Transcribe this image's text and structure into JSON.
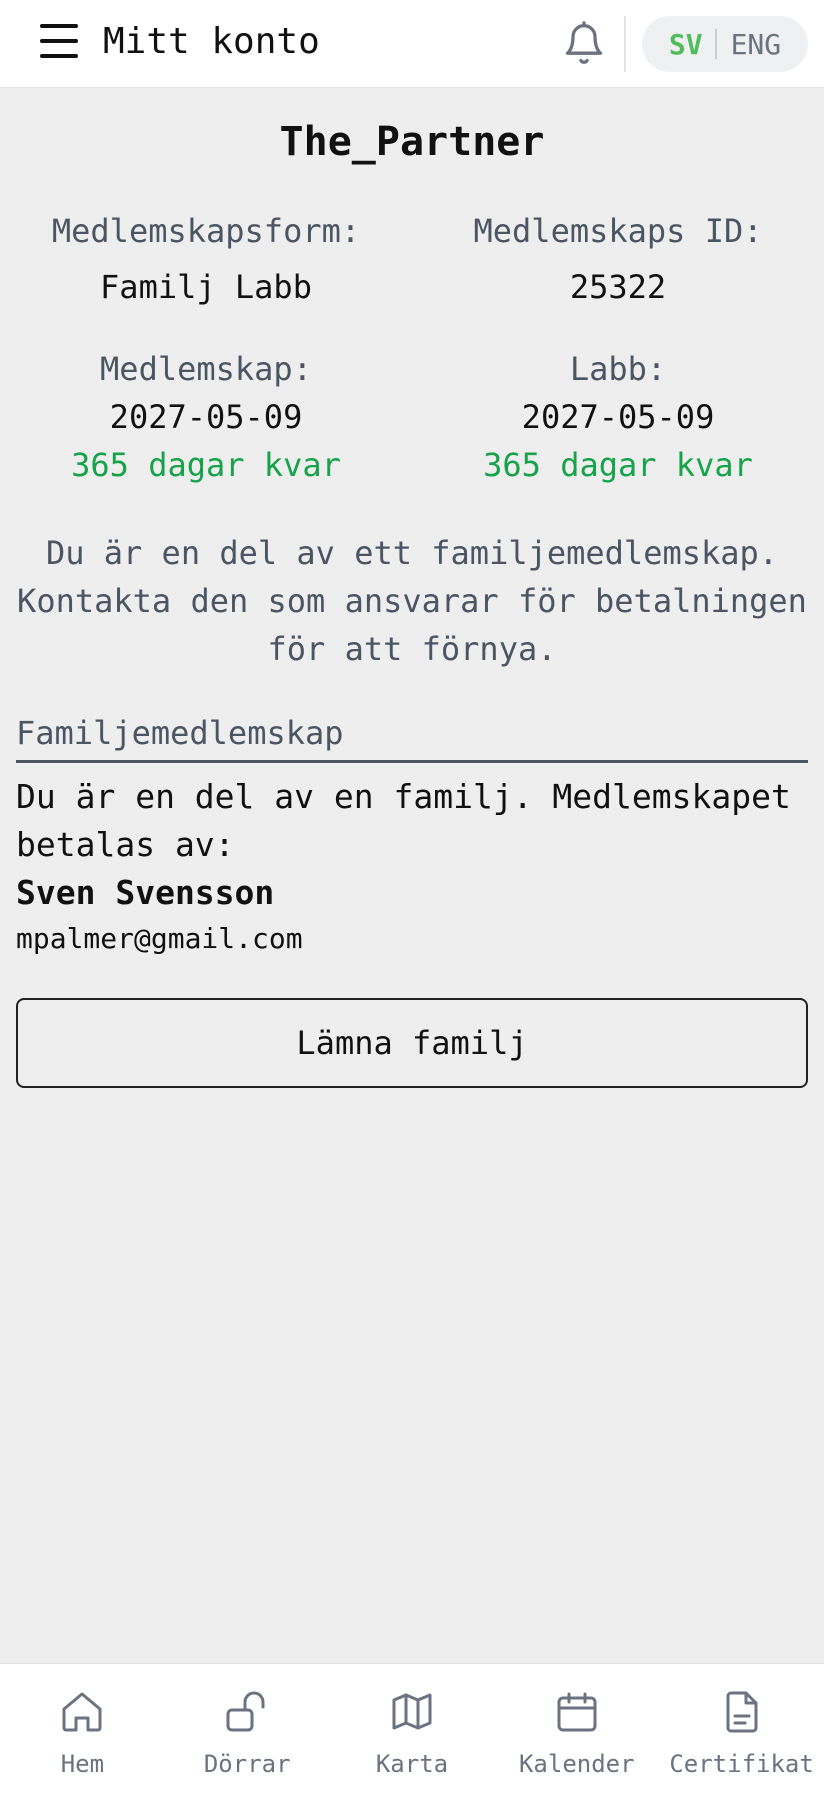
{
  "header": {
    "title": "Mitt konto",
    "menu_icon": "hamburger-icon",
    "bell_icon": "bell-icon",
    "lang": {
      "sv": "SV",
      "eng": "ENG",
      "active": "SV"
    }
  },
  "profile": {
    "name": "The_Partner",
    "membership_type_label": "Medlemskapsform:",
    "membership_type_value": "Familj Labb",
    "membership_id_label": "Medlemskaps ID:",
    "membership_id_value": "25322",
    "membership_label": "Medlemskap:",
    "membership_date": "2027-05-09",
    "membership_remaining": "365 dagar kvar",
    "lab_label": "Labb:",
    "lab_date": "2027-05-09",
    "lab_remaining": "365 dagar kvar"
  },
  "notice": {
    "line1": "Du är en del av ett familjemedlemskap.",
    "line2": "Kontakta den som ansvarar för betalningen",
    "line3": "för att förnya."
  },
  "family": {
    "section_title": "Familjemedlemskap",
    "description": "Du är en del av en familj. Medlemskapet betalas av:",
    "payer_name": "Sven Svensson",
    "payer_email": "mpalmer@gmail.com",
    "leave_label": "Lämna familj"
  },
  "nav": {
    "items": [
      {
        "label": "Hem",
        "icon": "home-icon"
      },
      {
        "label": "Dörrar",
        "icon": "unlock-icon"
      },
      {
        "label": "Karta",
        "icon": "map-icon"
      },
      {
        "label": "Kalender",
        "icon": "calendar-icon"
      },
      {
        "label": "Certifikat",
        "icon": "document-icon"
      }
    ]
  },
  "colors": {
    "accent_green": "#16a34a",
    "lang_active": "#4fbd5b",
    "muted_text": "#4b5563"
  }
}
